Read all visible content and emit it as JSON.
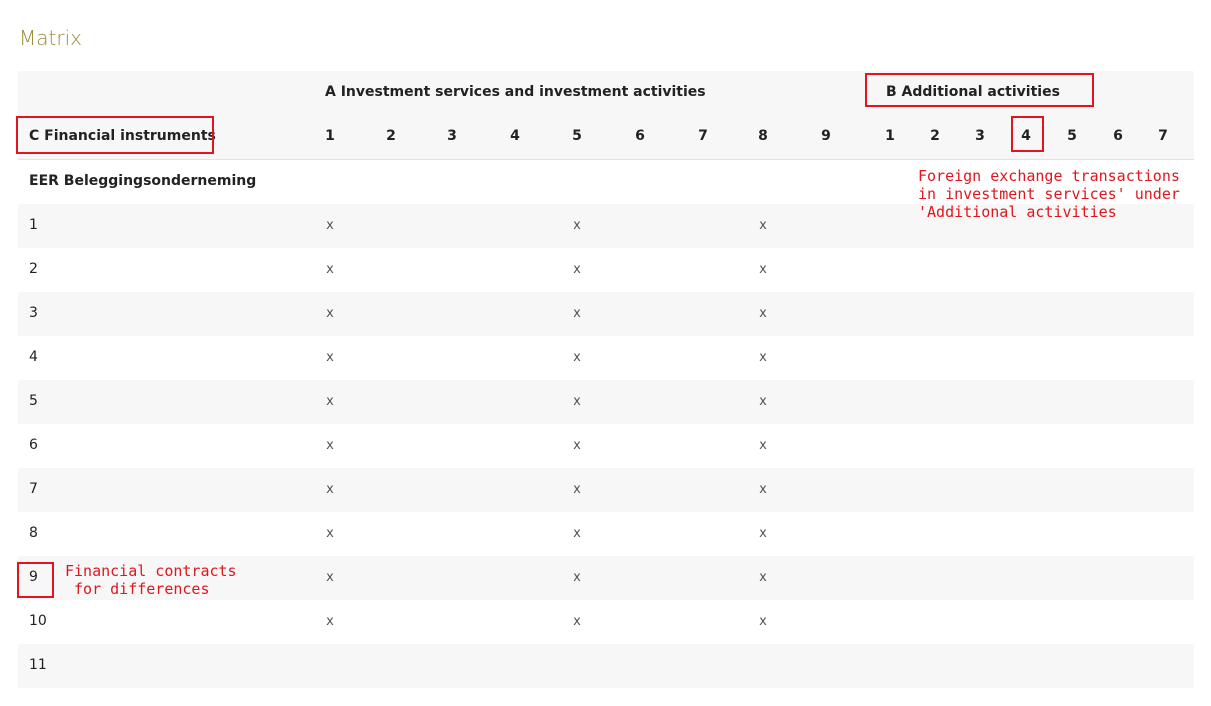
{
  "title": "Matrix",
  "header": {
    "corner": "C Financial instruments",
    "group_a": "A Investment services and investment activities",
    "group_b": "B Additional activities",
    "cols_a": [
      "1",
      "2",
      "3",
      "4",
      "5",
      "6",
      "7",
      "8",
      "9"
    ],
    "cols_b": [
      "1",
      "2",
      "3",
      "4",
      "5",
      "6",
      "7"
    ]
  },
  "section_label": "EER Beleggingsonderneming",
  "rows": [
    {
      "label": "1",
      "marks_a": [
        "1",
        "5",
        "8"
      ]
    },
    {
      "label": "2",
      "marks_a": [
        "1",
        "5",
        "8"
      ]
    },
    {
      "label": "3",
      "marks_a": [
        "1",
        "5",
        "8"
      ]
    },
    {
      "label": "4",
      "marks_a": [
        "1",
        "5",
        "8"
      ]
    },
    {
      "label": "5",
      "marks_a": [
        "1",
        "5",
        "8"
      ]
    },
    {
      "label": "6",
      "marks_a": [
        "1",
        "5",
        "8"
      ]
    },
    {
      "label": "7",
      "marks_a": [
        "1",
        "5",
        "8"
      ]
    },
    {
      "label": "8",
      "marks_a": [
        "1",
        "5",
        "8"
      ]
    },
    {
      "label": "9",
      "marks_a": [
        "1",
        "5",
        "8"
      ]
    },
    {
      "label": "10",
      "marks_a": [
        "1",
        "5",
        "8"
      ]
    },
    {
      "label": "11",
      "marks_a": []
    }
  ],
  "mark": "x",
  "annotations": {
    "b4_note": "Foreign exchange transactions\nin investment services' under\n'Additional activities",
    "row9_note": "Financial contracts\n for differences"
  },
  "colors": {
    "accent": "#9a8a3c",
    "annotation": "#e0161e"
  }
}
